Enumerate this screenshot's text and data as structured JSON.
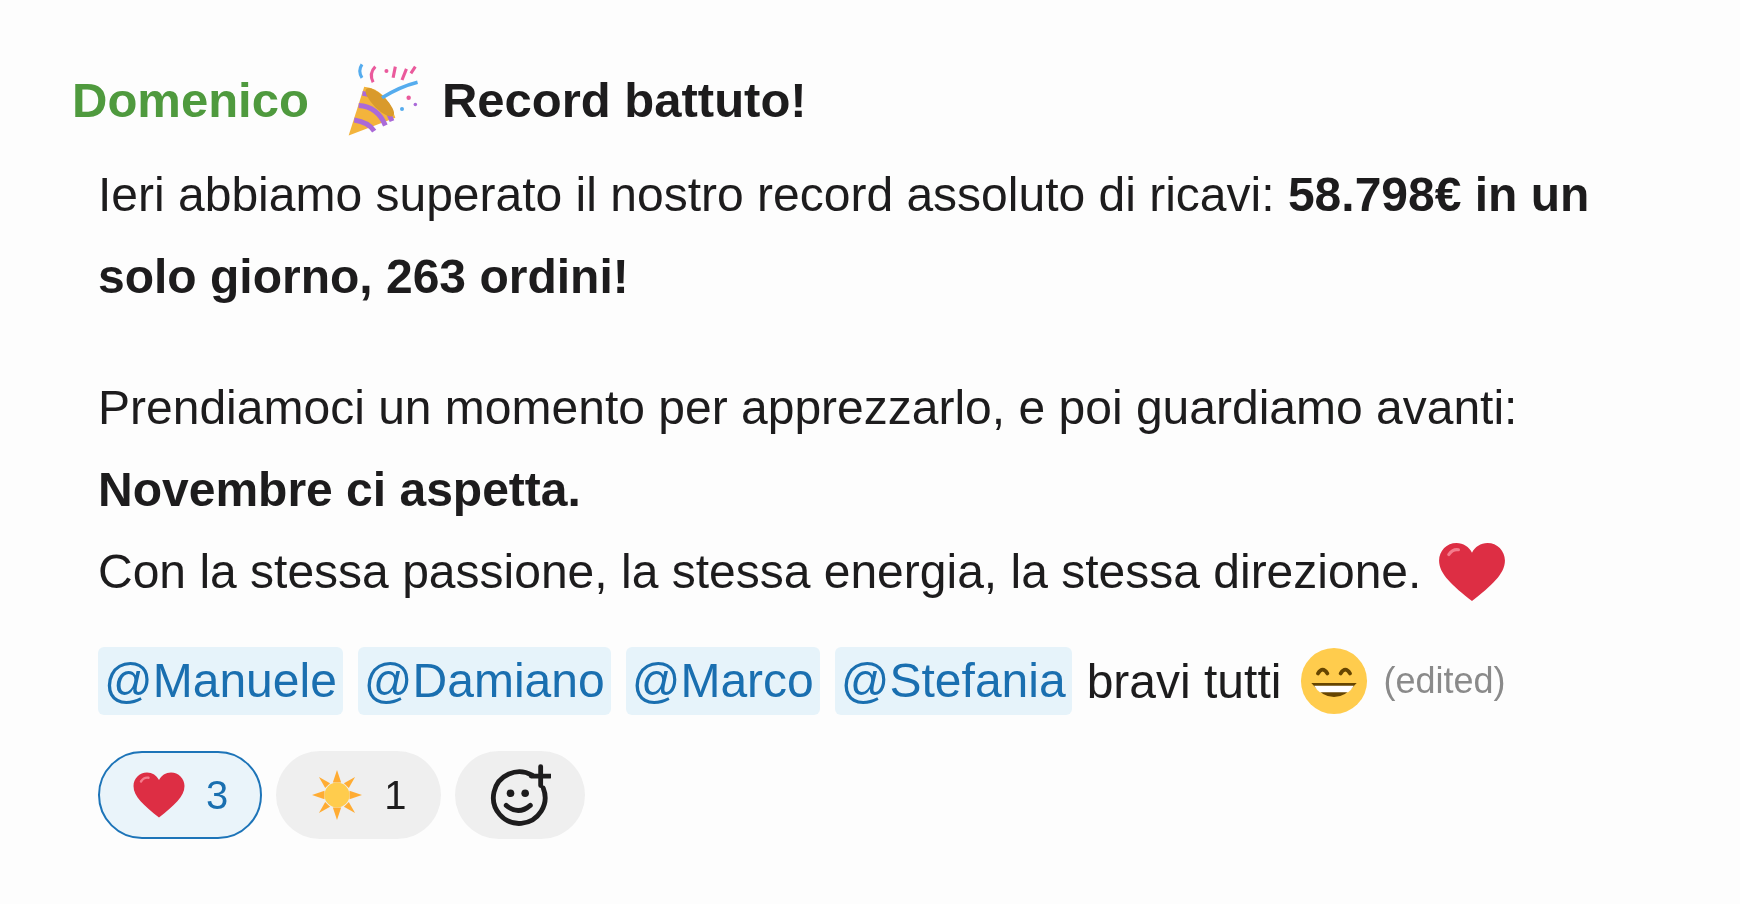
{
  "message": {
    "author": "Domenico",
    "title": "Record battuto!",
    "paragraphs": [
      {
        "lines": [
          {
            "text": "Ieri abbiamo superato il nostro record assoluto di ricavi: **58.798€ in un solo giorno, 263 ordini!**",
            "bold": false
          }
        ]
      },
      {
        "lines": [
          {
            "text": "Prendiamoci un momento per apprezzarlo, e poi guardiamo avanti:",
            "bold": false
          },
          {
            "text": "Novembre ci aspetta.",
            "bold": true
          },
          {
            "text": "Con la stessa passione, la stessa energia, la stessa direzione.",
            "bold": false
          }
        ]
      }
    ],
    "mentions": [
      "@Manuele",
      "@Damiano",
      "@Marco",
      "@Stefania"
    ],
    "closing_text": "bravi tutti",
    "edited_label": "(edited)"
  },
  "reactions": [
    {
      "count": "3",
      "selected": true
    },
    {
      "count": "1",
      "selected": false
    }
  ]
}
